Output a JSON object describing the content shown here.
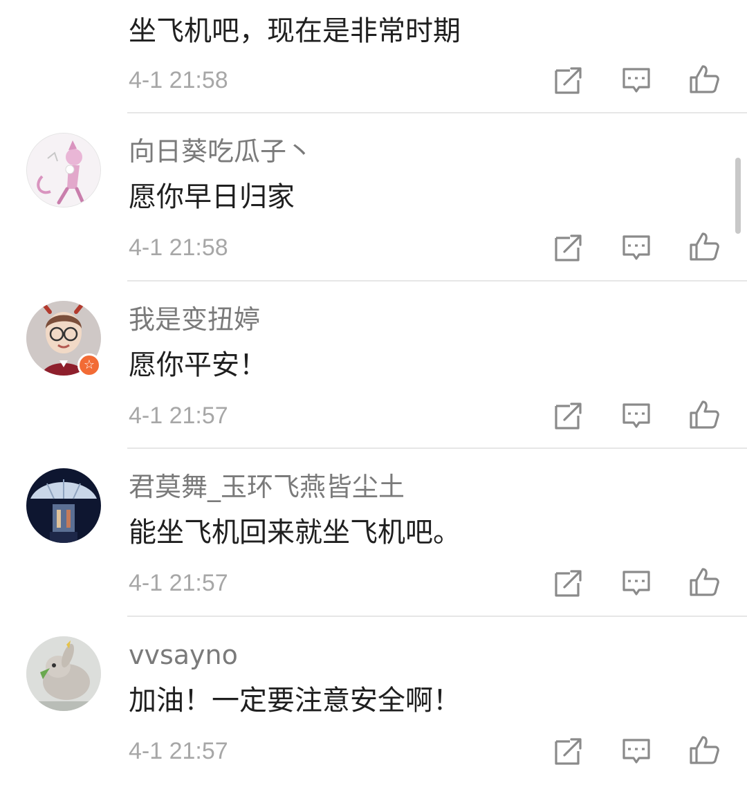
{
  "comments": [
    {
      "username": "",
      "text": "坐飞机吧，现在是非常时期",
      "time": "4-1 21:58",
      "avatar": "man-in-dark-outfit-avatar"
    },
    {
      "username": "向日葵吃瓜子丶",
      "text": "愿你早日归家",
      "time": "4-1 21:58",
      "avatar": "pink-cartoon-creature-avatar"
    },
    {
      "username": "我是变扭婷",
      "text": "愿你平安！",
      "time": "4-1 21:57",
      "avatar": "cartoon-girl-with-glasses-avatar",
      "badge": "☆"
    },
    {
      "username": "君莫舞_玉环飞燕皆尘土",
      "text": "能坐飞机回来就坐飞机吧。",
      "time": "4-1 21:57",
      "avatar": "umbrella-night-scene-avatar"
    },
    {
      "username": "vvsayno",
      "text": "加油！一定要注意安全啊！",
      "time": "4-1 21:57",
      "avatar": "bunny-eating-grass-avatar"
    }
  ],
  "actions": {
    "repost_icon": "repost-icon",
    "reply_icon": "reply-icon",
    "like_icon": "like-icon"
  },
  "colors": {
    "background": "#ffffff",
    "username": "#7a7a7a",
    "text": "#1f1f1f",
    "time": "#a7a7a7",
    "icon": "#8a8a8a",
    "divider": "#e6e6e6",
    "badge": "#f26b35"
  }
}
